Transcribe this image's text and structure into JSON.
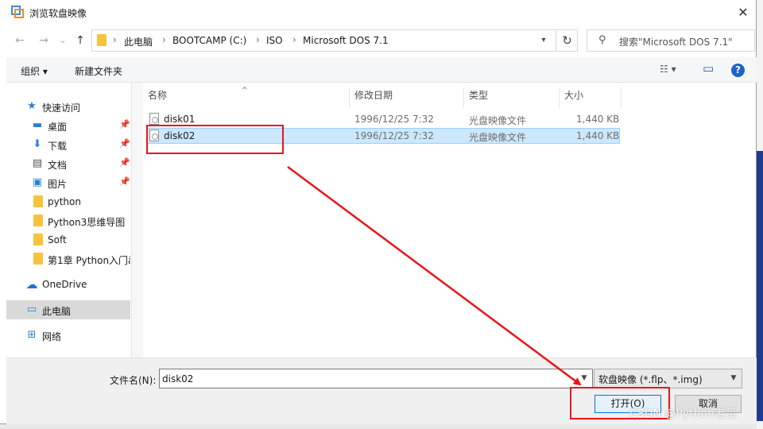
{
  "window": {
    "title": "浏览软盘映像",
    "close_glyph": "✕"
  },
  "nav": {
    "back": "←",
    "forward": "→",
    "recent": "⌄",
    "up": "↑"
  },
  "address": {
    "crumbs": [
      "此电脑",
      "BOOTCAMP (C:)",
      "ISO",
      "Microsoft DOS 7.1"
    ],
    "separator": "›",
    "refresh_glyph": "↻",
    "dropdown_glyph": "▾"
  },
  "search": {
    "placeholder": "搜索\"Microsoft DOS 7.1\"",
    "icon": "search-icon"
  },
  "toolbar": {
    "organize": "组织 ▾",
    "new_folder": "新建文件夹",
    "view_glyph": "☷ ▾",
    "pane_glyph": "▭",
    "help_glyph": "?"
  },
  "sidebar": {
    "items": [
      {
        "label": "快速访问",
        "icon": "star-icon",
        "glyph": "★",
        "color": "#2a7fd4"
      },
      {
        "label": "桌面",
        "icon": "desktop-icon",
        "glyph": "▬",
        "color": "#2a7fd4",
        "pinned": true
      },
      {
        "label": "下载",
        "icon": "download-icon",
        "glyph": "⬇",
        "color": "#2a7fd4",
        "pinned": true
      },
      {
        "label": "文档",
        "icon": "document-icon",
        "glyph": "▤",
        "color": "#555555",
        "pinned": true
      },
      {
        "label": "图片",
        "icon": "picture-icon",
        "glyph": "▣",
        "color": "#2a7fd4",
        "pinned": true
      },
      {
        "label": "python",
        "icon": "folder-icon"
      },
      {
        "label": "Python3思维导图",
        "icon": "folder-icon"
      },
      {
        "label": "Soft",
        "icon": "folder-icon"
      },
      {
        "label": "第1章 Python入门ā",
        "icon": "folder-icon"
      },
      {
        "label": "OneDrive",
        "icon": "cloud-icon",
        "glyph": "☁",
        "color": "#1a73d4"
      },
      {
        "label": "此电脑",
        "icon": "computer-icon",
        "glyph": "▭",
        "color": "#2a7fd4",
        "selected": true
      },
      {
        "label": "网络",
        "icon": "network-icon",
        "glyph": "⊞",
        "color": "#2a7fd4"
      }
    ],
    "pin_glyph": "📌"
  },
  "filelist": {
    "sort_glyph": "^",
    "columns": [
      "名称",
      "修改日期",
      "类型",
      "大小"
    ],
    "rows": [
      {
        "name": "disk01",
        "date": "1996/12/25 7:32",
        "type": "光盘映像文件",
        "size": "1,440 KB",
        "selected": false
      },
      {
        "name": "disk02",
        "date": "1996/12/25 7:32",
        "type": "光盘映像文件",
        "size": "1,440 KB",
        "selected": true
      }
    ]
  },
  "bottom": {
    "filename_label": "文件名(N):",
    "filename_value": "disk02",
    "filetype": "软盘映像 (*.flp、*.img)",
    "open_label": "打开(O)",
    "cancel_label": "取消"
  },
  "watermark": "CSDN @Python老吕",
  "annotation_color": "#e8161a"
}
